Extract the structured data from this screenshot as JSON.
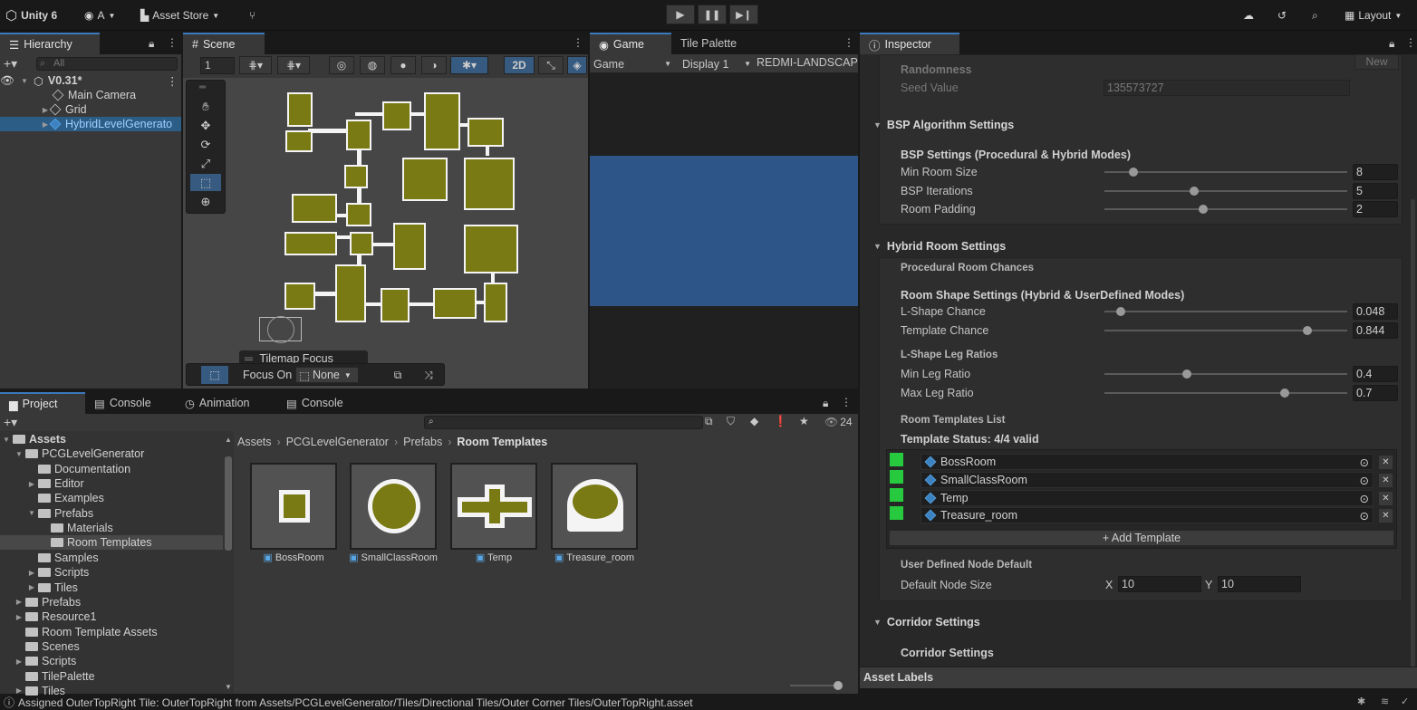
{
  "topbar": {
    "app": "Unity 6",
    "account": "A",
    "asset_store": "Asset Store",
    "layout": "Layout"
  },
  "hierarchy": {
    "tab": "Hierarchy",
    "search_placeholder": "All",
    "scene": "V0.31*",
    "items": [
      "Main Camera",
      "Grid",
      "HybridLevelGenerato"
    ]
  },
  "scene": {
    "tab": "Scene",
    "field_value": "1",
    "mode_2d": "2D",
    "overlay_title": "Tilemap Focus",
    "focus_on_label": "Focus On",
    "focus_value": "None"
  },
  "game": {
    "tabs": [
      "Game",
      "Tile Palette"
    ],
    "dropdown_game": "Game",
    "display": "Display 1",
    "resolution": "REDMI-LANDSCAP"
  },
  "inspector": {
    "tab": "Inspector",
    "new_button": "New",
    "randomness": "Randomness",
    "seed_label": "Seed Value",
    "seed_value": "135573727",
    "bsp_section": "BSP Algorithm Settings",
    "bsp_subheading": "BSP Settings (Procedural & Hybrid Modes)",
    "bsp_fields": [
      {
        "label": "Min Room Size",
        "value": "8"
      },
      {
        "label": "BSP Iterations",
        "value": "5"
      },
      {
        "label": "Room Padding",
        "value": "2"
      }
    ],
    "hybrid_section": "Hybrid Room Settings",
    "procedural_chances": "Procedural Room Chances",
    "shape_heading": "Room Shape Settings (Hybrid & UserDefined Modes)",
    "shape_fields": [
      {
        "label": "L-Shape Chance",
        "value": "0.048"
      },
      {
        "label": "Template Chance",
        "value": "0.844"
      }
    ],
    "leg_heading": "L-Shape Leg Ratios",
    "leg_fields": [
      {
        "label": "Min Leg Ratio",
        "value": "0.4"
      },
      {
        "label": "Max Leg Ratio",
        "value": "0.7"
      }
    ],
    "templates_list_label": "Room Templates List",
    "template_status": "Template Status: 4/4 valid",
    "templates": [
      "BossRoom",
      "SmallClassRoom",
      "Temp",
      "Treasure_room"
    ],
    "add_template": "+ Add Template",
    "user_defined_label": "User Defined Node Default",
    "default_node_size_label": "Default Node Size",
    "node_x_label": "X",
    "node_x": "10",
    "node_y_label": "Y",
    "node_y": "10",
    "corridor_section": "Corridor Settings",
    "corridor_subheading": "Corridor Settings",
    "asset_labels": "Asset Labels"
  },
  "project": {
    "tabs": [
      "Project",
      "Console",
      "Animation",
      "Console"
    ],
    "count": "24",
    "tree": [
      {
        "label": "Assets",
        "level": 0,
        "bold": true
      },
      {
        "label": "PCGLevelGenerator",
        "level": 1
      },
      {
        "label": "Documentation",
        "level": 2
      },
      {
        "label": "Editor",
        "level": 2
      },
      {
        "label": "Examples",
        "level": 2
      },
      {
        "label": "Prefabs",
        "level": 2
      },
      {
        "label": "Materials",
        "level": 3
      },
      {
        "label": "Room Templates",
        "level": 3,
        "selected": true
      },
      {
        "label": "Samples",
        "level": 2
      },
      {
        "label": "Scripts",
        "level": 2
      },
      {
        "label": "Tiles",
        "level": 2
      },
      {
        "label": "Prefabs",
        "level": 1
      },
      {
        "label": "Resource1",
        "level": 1
      },
      {
        "label": "Room Template Assets",
        "level": 1
      },
      {
        "label": "Scenes",
        "level": 1
      },
      {
        "label": "Scripts",
        "level": 1
      },
      {
        "label": "TilePalette",
        "level": 1
      },
      {
        "label": "Tiles",
        "level": 1
      }
    ],
    "breadcrumb": [
      "Assets",
      "PCGLevelGenerator",
      "Prefabs",
      "Room Templates"
    ],
    "assets": [
      "BossRoom",
      "SmallClassRoom",
      "Temp",
      "Treasure_room"
    ]
  },
  "status_bar": {
    "message": "Assigned OuterTopRight Tile: OuterTopRight from Assets/PCGLevelGenerator/Tiles/Directional Tiles/Outer Corner Tiles/OuterTopRight.asset"
  }
}
